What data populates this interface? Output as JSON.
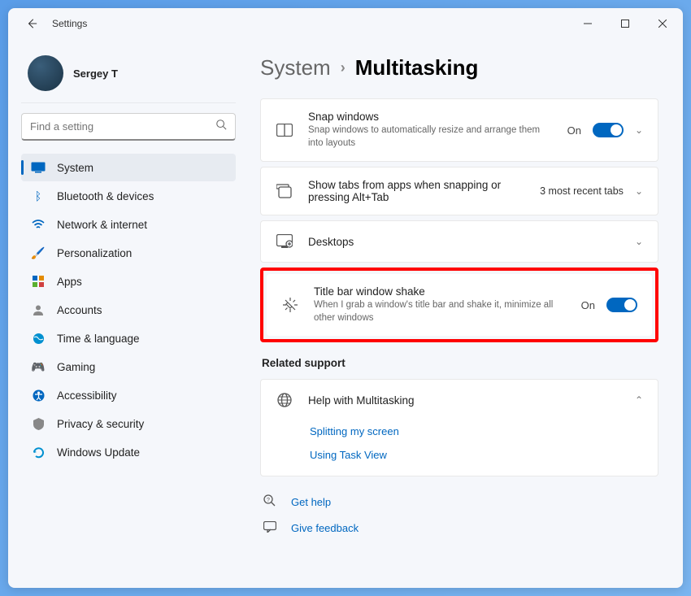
{
  "window": {
    "title": "Settings"
  },
  "profile": {
    "name": "Sergey T"
  },
  "search": {
    "placeholder": "Find a setting"
  },
  "nav": [
    {
      "icon": "system",
      "label": "System",
      "active": true
    },
    {
      "icon": "bluetooth",
      "label": "Bluetooth & devices"
    },
    {
      "icon": "network",
      "label": "Network & internet"
    },
    {
      "icon": "personalization",
      "label": "Personalization"
    },
    {
      "icon": "apps",
      "label": "Apps"
    },
    {
      "icon": "accounts",
      "label": "Accounts"
    },
    {
      "icon": "time",
      "label": "Time & language"
    },
    {
      "icon": "gaming",
      "label": "Gaming"
    },
    {
      "icon": "accessibility",
      "label": "Accessibility"
    },
    {
      "icon": "privacy",
      "label": "Privacy & security"
    },
    {
      "icon": "update",
      "label": "Windows Update"
    }
  ],
  "breadcrumb": {
    "parent": "System",
    "current": "Multitasking"
  },
  "cards": {
    "snap": {
      "title": "Snap windows",
      "desc": "Snap windows to automatically resize and arrange them into layouts",
      "state": "On"
    },
    "tabs": {
      "title": "Show tabs from apps when snapping or pressing Alt+Tab",
      "value": "3 most recent tabs"
    },
    "desktops": {
      "title": "Desktops"
    },
    "shake": {
      "title": "Title bar window shake",
      "desc": "When I grab a window's title bar and shake it, minimize all other windows",
      "state": "On"
    }
  },
  "related": {
    "label": "Related support",
    "help_title": "Help with Multitasking",
    "links": [
      "Splitting my screen",
      "Using Task View"
    ]
  },
  "footer": {
    "get_help": "Get help",
    "feedback": "Give feedback"
  }
}
